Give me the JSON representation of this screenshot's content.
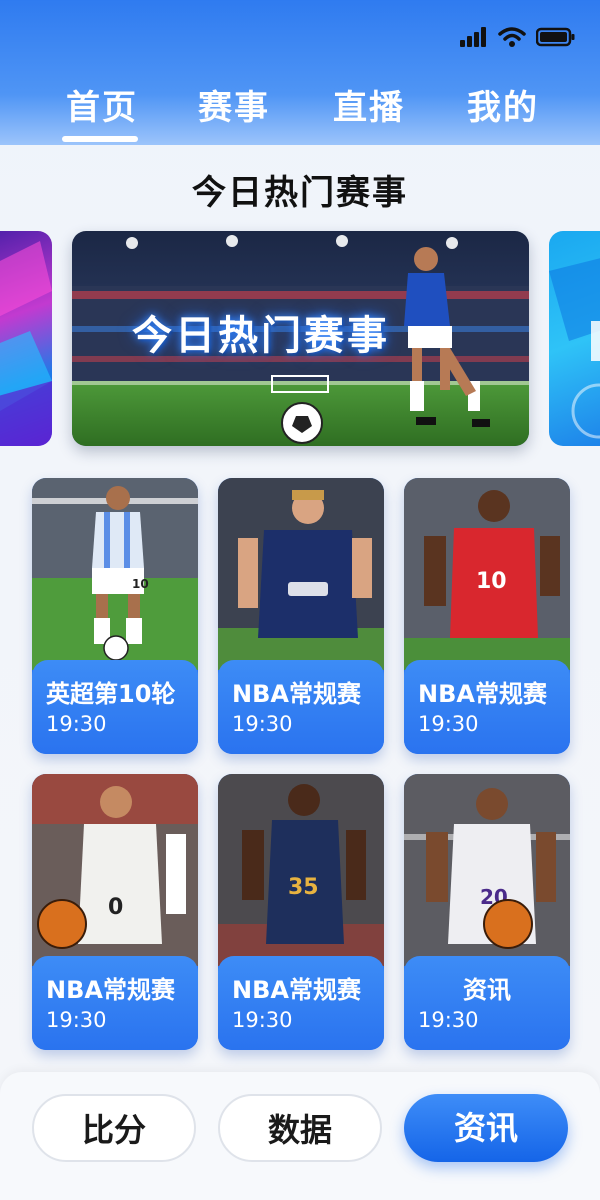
{
  "header": {
    "tabs": [
      {
        "label": "首页",
        "active": true
      },
      {
        "label": "赛事",
        "active": false
      },
      {
        "label": "直播",
        "active": false
      },
      {
        "label": "我的",
        "active": false
      }
    ]
  },
  "section_title": "今日热门赛事",
  "banner": {
    "title": "今日热门赛事"
  },
  "cards": [
    {
      "title": "英超第10轮",
      "time": "19:30",
      "jersey": "10"
    },
    {
      "title": "NBA常规赛",
      "time": "19:30",
      "jersey": ""
    },
    {
      "title": "NBA常规赛",
      "time": "19:30",
      "jersey": "10"
    },
    {
      "title": "NBA常规赛",
      "time": "19:30",
      "jersey": "0"
    },
    {
      "title": "NBA常规赛",
      "time": "19:30",
      "jersey": "35"
    },
    {
      "title": "资讯",
      "time": "19:30",
      "jersey": "20"
    }
  ],
  "bottom_nav": [
    {
      "label": "比分",
      "active": false
    },
    {
      "label": "数据",
      "active": false
    },
    {
      "label": "资讯",
      "active": true
    }
  ],
  "colors": {
    "brand_blue": "#2b76ef",
    "active_button": "#1565e8"
  }
}
